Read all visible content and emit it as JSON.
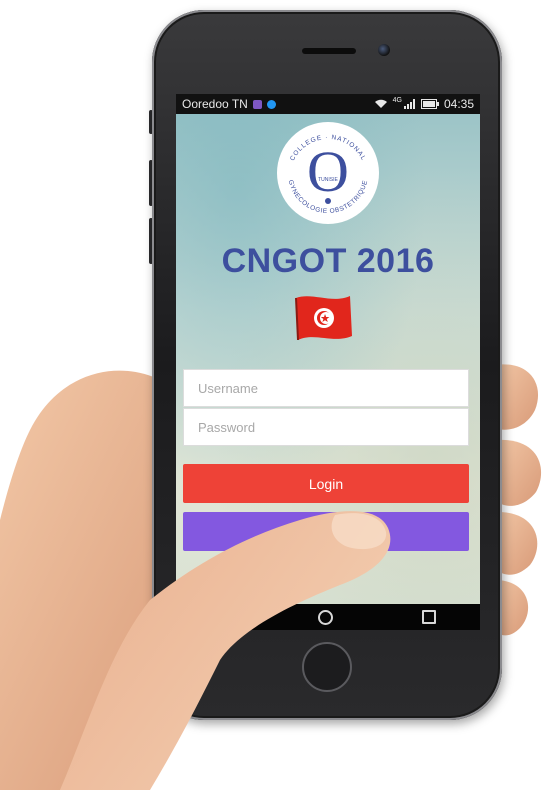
{
  "status_bar": {
    "carrier": "Ooredoo TN",
    "network": "4G",
    "time": "04:35"
  },
  "app": {
    "logo": {
      "arc_text_top": "COLLEGE · NATIONAL",
      "arc_text_bottom": "GYNECOLOGIE OBSTETRIQUE",
      "center_letter": "O",
      "inner_text": "TUNISIE"
    },
    "title": "CNGOT 2016",
    "username_placeholder": "Username",
    "password_placeholder": "Password",
    "login_label": "Login",
    "second_button_label": ""
  },
  "colors": {
    "title": "#3d4f9e",
    "login_button": "#ee4237",
    "second_button": "#8358e0",
    "flag_red": "#e1261c"
  },
  "icons": [
    "wifi-icon",
    "signal-icon",
    "battery-icon",
    "back-icon",
    "home-icon",
    "recent-apps-icon",
    "tunisia-flag-icon"
  ]
}
